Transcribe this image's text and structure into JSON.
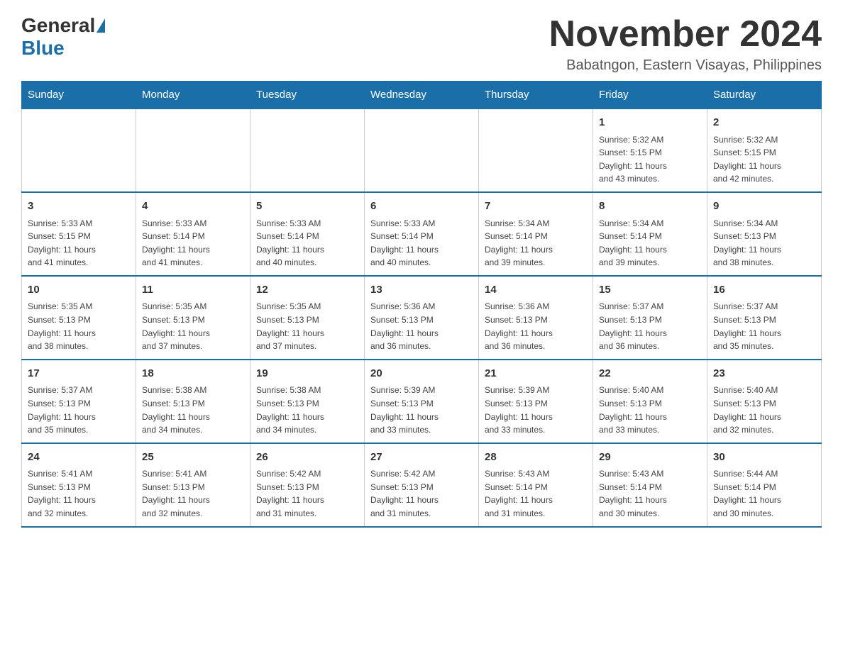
{
  "logo": {
    "general": "General",
    "blue": "Blue"
  },
  "header": {
    "month_year": "November 2024",
    "location": "Babatngon, Eastern Visayas, Philippines"
  },
  "weekdays": [
    "Sunday",
    "Monday",
    "Tuesday",
    "Wednesday",
    "Thursday",
    "Friday",
    "Saturday"
  ],
  "weeks": [
    [
      {
        "day": "",
        "info": ""
      },
      {
        "day": "",
        "info": ""
      },
      {
        "day": "",
        "info": ""
      },
      {
        "day": "",
        "info": ""
      },
      {
        "day": "",
        "info": ""
      },
      {
        "day": "1",
        "info": "Sunrise: 5:32 AM\nSunset: 5:15 PM\nDaylight: 11 hours\nand 43 minutes."
      },
      {
        "day": "2",
        "info": "Sunrise: 5:32 AM\nSunset: 5:15 PM\nDaylight: 11 hours\nand 42 minutes."
      }
    ],
    [
      {
        "day": "3",
        "info": "Sunrise: 5:33 AM\nSunset: 5:15 PM\nDaylight: 11 hours\nand 41 minutes."
      },
      {
        "day": "4",
        "info": "Sunrise: 5:33 AM\nSunset: 5:14 PM\nDaylight: 11 hours\nand 41 minutes."
      },
      {
        "day": "5",
        "info": "Sunrise: 5:33 AM\nSunset: 5:14 PM\nDaylight: 11 hours\nand 40 minutes."
      },
      {
        "day": "6",
        "info": "Sunrise: 5:33 AM\nSunset: 5:14 PM\nDaylight: 11 hours\nand 40 minutes."
      },
      {
        "day": "7",
        "info": "Sunrise: 5:34 AM\nSunset: 5:14 PM\nDaylight: 11 hours\nand 39 minutes."
      },
      {
        "day": "8",
        "info": "Sunrise: 5:34 AM\nSunset: 5:14 PM\nDaylight: 11 hours\nand 39 minutes."
      },
      {
        "day": "9",
        "info": "Sunrise: 5:34 AM\nSunset: 5:13 PM\nDaylight: 11 hours\nand 38 minutes."
      }
    ],
    [
      {
        "day": "10",
        "info": "Sunrise: 5:35 AM\nSunset: 5:13 PM\nDaylight: 11 hours\nand 38 minutes."
      },
      {
        "day": "11",
        "info": "Sunrise: 5:35 AM\nSunset: 5:13 PM\nDaylight: 11 hours\nand 37 minutes."
      },
      {
        "day": "12",
        "info": "Sunrise: 5:35 AM\nSunset: 5:13 PM\nDaylight: 11 hours\nand 37 minutes."
      },
      {
        "day": "13",
        "info": "Sunrise: 5:36 AM\nSunset: 5:13 PM\nDaylight: 11 hours\nand 36 minutes."
      },
      {
        "day": "14",
        "info": "Sunrise: 5:36 AM\nSunset: 5:13 PM\nDaylight: 11 hours\nand 36 minutes."
      },
      {
        "day": "15",
        "info": "Sunrise: 5:37 AM\nSunset: 5:13 PM\nDaylight: 11 hours\nand 36 minutes."
      },
      {
        "day": "16",
        "info": "Sunrise: 5:37 AM\nSunset: 5:13 PM\nDaylight: 11 hours\nand 35 minutes."
      }
    ],
    [
      {
        "day": "17",
        "info": "Sunrise: 5:37 AM\nSunset: 5:13 PM\nDaylight: 11 hours\nand 35 minutes."
      },
      {
        "day": "18",
        "info": "Sunrise: 5:38 AM\nSunset: 5:13 PM\nDaylight: 11 hours\nand 34 minutes."
      },
      {
        "day": "19",
        "info": "Sunrise: 5:38 AM\nSunset: 5:13 PM\nDaylight: 11 hours\nand 34 minutes."
      },
      {
        "day": "20",
        "info": "Sunrise: 5:39 AM\nSunset: 5:13 PM\nDaylight: 11 hours\nand 33 minutes."
      },
      {
        "day": "21",
        "info": "Sunrise: 5:39 AM\nSunset: 5:13 PM\nDaylight: 11 hours\nand 33 minutes."
      },
      {
        "day": "22",
        "info": "Sunrise: 5:40 AM\nSunset: 5:13 PM\nDaylight: 11 hours\nand 33 minutes."
      },
      {
        "day": "23",
        "info": "Sunrise: 5:40 AM\nSunset: 5:13 PM\nDaylight: 11 hours\nand 32 minutes."
      }
    ],
    [
      {
        "day": "24",
        "info": "Sunrise: 5:41 AM\nSunset: 5:13 PM\nDaylight: 11 hours\nand 32 minutes."
      },
      {
        "day": "25",
        "info": "Sunrise: 5:41 AM\nSunset: 5:13 PM\nDaylight: 11 hours\nand 32 minutes."
      },
      {
        "day": "26",
        "info": "Sunrise: 5:42 AM\nSunset: 5:13 PM\nDaylight: 11 hours\nand 31 minutes."
      },
      {
        "day": "27",
        "info": "Sunrise: 5:42 AM\nSunset: 5:13 PM\nDaylight: 11 hours\nand 31 minutes."
      },
      {
        "day": "28",
        "info": "Sunrise: 5:43 AM\nSunset: 5:14 PM\nDaylight: 11 hours\nand 31 minutes."
      },
      {
        "day": "29",
        "info": "Sunrise: 5:43 AM\nSunset: 5:14 PM\nDaylight: 11 hours\nand 30 minutes."
      },
      {
        "day": "30",
        "info": "Sunrise: 5:44 AM\nSunset: 5:14 PM\nDaylight: 11 hours\nand 30 minutes."
      }
    ]
  ]
}
